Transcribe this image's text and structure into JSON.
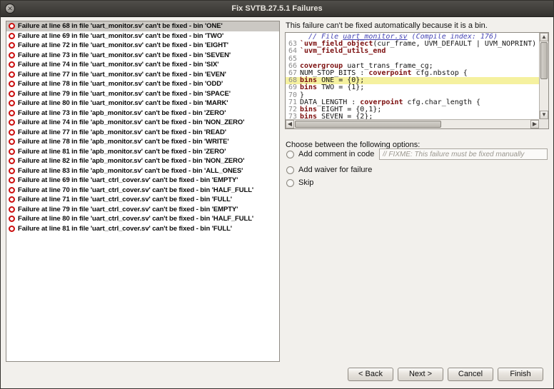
{
  "window": {
    "title": "Fix SVTB.27.5.1 Failures",
    "close_glyph": "✕"
  },
  "colors": {
    "error_icon": "#cb0e0e",
    "line_highlight": "#f5f19f",
    "keyword": "#7b0d0d",
    "comment": "#4545b5",
    "selected_row": "#cbc8c3"
  },
  "failures": {
    "items": [
      {
        "label": "Failure at line 68 in file 'uart_monitor.sv' can't be fixed - bin 'ONE'",
        "selected": true
      },
      {
        "label": "Failure at line 69 in file 'uart_monitor.sv' can't be fixed - bin 'TWO'",
        "selected": false
      },
      {
        "label": "Failure at line 72 in file 'uart_monitor.sv' can't be fixed - bin 'EIGHT'",
        "selected": false
      },
      {
        "label": "Failure at line 73 in file 'uart_monitor.sv' can't be fixed - bin 'SEVEN'",
        "selected": false
      },
      {
        "label": "Failure at line 74 in file 'uart_monitor.sv' can't be fixed - bin 'SIX'",
        "selected": false
      },
      {
        "label": "Failure at line 77 in file 'uart_monitor.sv' can't be fixed - bin 'EVEN'",
        "selected": false
      },
      {
        "label": "Failure at line 78 in file 'uart_monitor.sv' can't be fixed - bin 'ODD'",
        "selected": false
      },
      {
        "label": "Failure at line 79 in file 'uart_monitor.sv' can't be fixed - bin 'SPACE'",
        "selected": false
      },
      {
        "label": "Failure at line 80 in file 'uart_monitor.sv' can't be fixed - bin 'MARK'",
        "selected": false
      },
      {
        "label": "Failure at line 73 in file 'apb_monitor.sv' can't be fixed - bin 'ZERO'",
        "selected": false
      },
      {
        "label": "Failure at line 74 in file 'apb_monitor.sv' can't be fixed - bin 'NON_ZERO'",
        "selected": false
      },
      {
        "label": "Failure at line 77 in file 'apb_monitor.sv' can't be fixed - bin 'READ'",
        "selected": false
      },
      {
        "label": "Failure at line 78 in file 'apb_monitor.sv' can't be fixed - bin 'WRITE'",
        "selected": false
      },
      {
        "label": "Failure at line 81 in file 'apb_monitor.sv' can't be fixed - bin 'ZERO'",
        "selected": false
      },
      {
        "label": "Failure at line 82 in file 'apb_monitor.sv' can't be fixed - bin 'NON_ZERO'",
        "selected": false
      },
      {
        "label": "Failure at line 83 in file 'apb_monitor.sv' can't be fixed - bin 'ALL_ONES'",
        "selected": false
      },
      {
        "label": "Failure at line 69 in file 'uart_ctrl_cover.sv' can't be fixed - bin 'EMPTY'",
        "selected": false
      },
      {
        "label": "Failure at line 70 in file 'uart_ctrl_cover.sv' can't be fixed - bin 'HALF_FULL'",
        "selected": false
      },
      {
        "label": "Failure at line 71 in file 'uart_ctrl_cover.sv' can't be fixed - bin 'FULL'",
        "selected": false
      },
      {
        "label": "Failure at line 79 in file 'uart_ctrl_cover.sv' can't be fixed - bin 'EMPTY'",
        "selected": false
      },
      {
        "label": "Failure at line 80 in file 'uart_ctrl_cover.sv' can't be fixed - bin 'HALF_FULL'",
        "selected": false
      },
      {
        "label": "Failure at line 81 in file 'uart_ctrl_cover.sv' can't be fixed - bin 'FULL'",
        "selected": false
      }
    ]
  },
  "detail": {
    "heading": "This failure can't be fixed automatically because it is a bin.",
    "code": {
      "lines": [
        {
          "num": "",
          "highlight": false,
          "tokens": [
            {
              "c": "comment",
              "t": "  // File "
            },
            {
              "c": "link",
              "t": "uart_monitor.sv"
            },
            {
              "c": "comment",
              "t": " (Compile index: 176)"
            }
          ]
        },
        {
          "num": "63",
          "highlight": false,
          "tokens": [
            {
              "c": "macro",
              "t": "`uvm_field_object"
            },
            {
              "c": "plain",
              "t": "(cur_frame, UVM_DEFAULT | UVM_NOPRINT)"
            }
          ]
        },
        {
          "num": "64",
          "highlight": false,
          "tokens": [
            {
              "c": "macro",
              "t": "`uvm_field_utils_end"
            }
          ]
        },
        {
          "num": "65",
          "highlight": false,
          "tokens": []
        },
        {
          "num": "66",
          "highlight": false,
          "tokens": [
            {
              "c": "kw",
              "t": "covergroup"
            },
            {
              "c": "plain",
              "t": " uart_trans_frame_cg;"
            }
          ]
        },
        {
          "num": "67",
          "highlight": false,
          "tokens": [
            {
              "c": "plain",
              "t": "NUM_STOP_BITS : "
            },
            {
              "c": "kw",
              "t": "coverpoint"
            },
            {
              "c": "plain",
              "t": " cfg.nbstop {"
            }
          ]
        },
        {
          "num": "68",
          "highlight": true,
          "tokens": [
            {
              "c": "kw",
              "t": "bins"
            },
            {
              "c": "plain",
              "t": " ONE = {0};"
            }
          ]
        },
        {
          "num": "69",
          "highlight": false,
          "tokens": [
            {
              "c": "kw",
              "t": "bins"
            },
            {
              "c": "plain",
              "t": " TWO = {1};"
            }
          ]
        },
        {
          "num": "70",
          "highlight": false,
          "tokens": [
            {
              "c": "plain",
              "t": "}"
            }
          ]
        },
        {
          "num": "71",
          "highlight": false,
          "tokens": [
            {
              "c": "plain",
              "t": "DATA_LENGTH : "
            },
            {
              "c": "kw",
              "t": "coverpoint"
            },
            {
              "c": "plain",
              "t": " cfg.char_length {"
            }
          ]
        },
        {
          "num": "72",
          "highlight": false,
          "tokens": [
            {
              "c": "kw",
              "t": "bins"
            },
            {
              "c": "plain",
              "t": " EIGHT = {0,1};"
            }
          ]
        },
        {
          "num": "73",
          "highlight": false,
          "tokens": [
            {
              "c": "kw",
              "t": "bins"
            },
            {
              "c": "plain",
              "t": " SEVEN = {2};"
            }
          ]
        }
      ]
    },
    "options_label": "Choose between the following options:",
    "options": [
      {
        "label": "Add comment in code",
        "placeholder": "// FIXME: This failure must be fixed manually"
      },
      {
        "label": "Add waiver for failure"
      },
      {
        "label": "Skip"
      }
    ]
  },
  "buttons": {
    "back": "< Back",
    "next": "Next >",
    "cancel": "Cancel",
    "finish": "Finish"
  }
}
